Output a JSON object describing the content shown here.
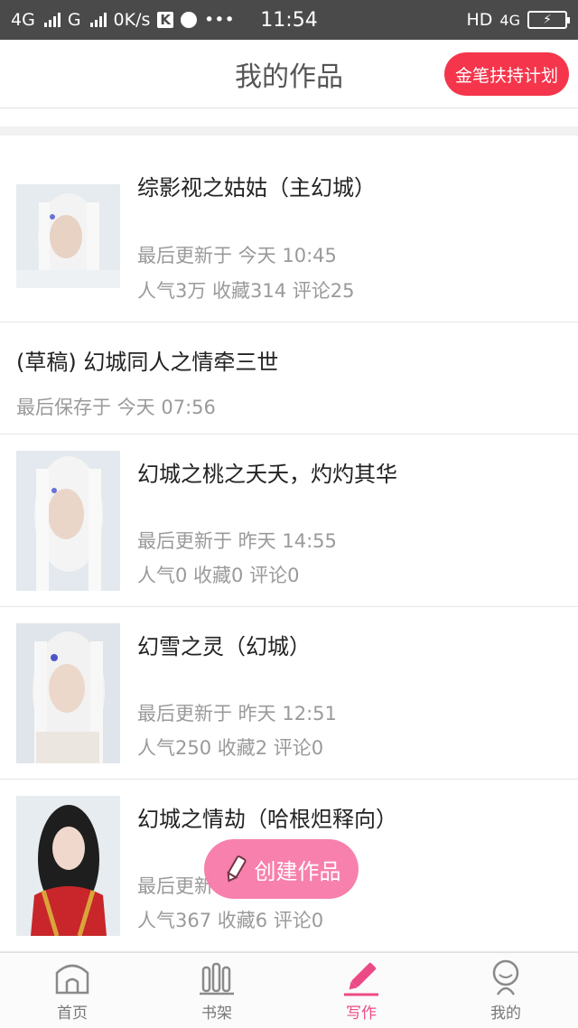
{
  "status_bar": {
    "left_network_1": "4G",
    "left_network_2": "G",
    "speed": "0K/s",
    "k_badge": "K",
    "more": "•••",
    "time": "11:54",
    "right_hd": "HD",
    "right_network": "4G"
  },
  "header": {
    "title": "我的作品",
    "support_button": "金笔扶持计划"
  },
  "works": [
    {
      "title": "综影视之姑姑（主幻城）",
      "update": "最后更新于 今天 10:45",
      "stats": "人气3万 收藏314 评论25"
    },
    {
      "title": "(草稿) 幻城同人之情牵三世",
      "update": "最后保存于 今天 07:56"
    },
    {
      "title": "幻城之桃之夭夭，灼灼其华",
      "update": "最后更新于 昨天 14:55",
      "stats": "人气0 收藏0 评论0"
    },
    {
      "title": "幻雪之灵（幻城）",
      "update": "最后更新于 昨天 12:51",
      "stats": "人气250 收藏2 评论0"
    },
    {
      "title": "幻城之情劫（哈根炟释向）",
      "update": "最后更新",
      "stats": "人气367 收藏6 评论0"
    }
  ],
  "create_button": "创建作品",
  "nav": {
    "home": "首页",
    "shelf": "书架",
    "write": "写作",
    "mine": "我的"
  },
  "colors": {
    "accent": "#ec4a86",
    "support": "#f5354b",
    "status_bar": "#4a4a4a"
  }
}
